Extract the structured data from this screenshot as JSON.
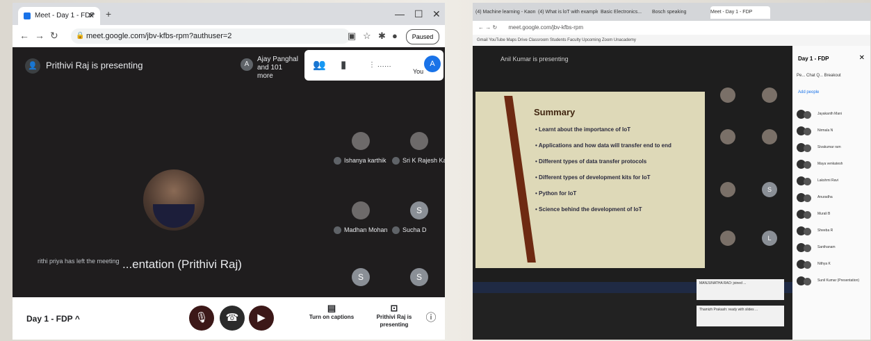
{
  "left": {
    "tab_title": "Meet - Day 1 - FDP",
    "url": "meet.google.com/jbv-kfbs-rpm?authuser=2",
    "paused_label": "Paused",
    "presenting_label": "Prithivi Raj is presenting",
    "joiners": {
      "initial": "A",
      "text": "Ajay Panghal and 101 more"
    },
    "you_label": "You",
    "you_initial": "A",
    "main_caption": "...entation (Prithivi Raj)",
    "left_notice": "rithi priya has left the meeting",
    "participants": [
      {
        "name": "Ishanya karthik",
        "initial": ""
      },
      {
        "name": "Sri K Rajesh Ka",
        "initial": ""
      },
      {
        "name": "Madhan Mohan",
        "initial": ""
      },
      {
        "name": "Sucha D",
        "initial": "S"
      },
      {
        "name": "",
        "initial": "S"
      },
      {
        "name": "",
        "initial": "S"
      }
    ],
    "meeting_name": "Day 1 - FDP",
    "captions_label": "Turn on captions",
    "present_label": "Prithivi Raj is presenting"
  },
  "right": {
    "tabs": [
      "(4) Machine learning - Kaon...",
      "(4) What is loT with example",
      "Basic Electronics...",
      "Bosch speaking",
      "Meet - Day 1 - FDP"
    ],
    "address": "meet.google.com/jbv-kfbs-rpm",
    "bookmarks": "Gmail  YouTube  Maps  Drive  Classroom  Students  Faculty  Upcoming  Zoom  Unacademy",
    "presenting_label": "Anil Kumar is presenting",
    "slide": {
      "title": "Summary",
      "bullets": [
        "Learnt about the importance of IoT",
        "Applications and how data will transfer end to end",
        "Different types of data transfer protocols",
        "Different types of development kits for IoT",
        "Python for IoT",
        "Science behind the development of IoT"
      ]
    },
    "tile_letters": [
      "S",
      "L"
    ],
    "sidebar": {
      "title": "Day 1 - FDP",
      "tabs": "Pe...  Chat  Q...  Breakout",
      "add_people": "Add people",
      "names": [
        "Jayakanth Mani",
        "Nirmala N",
        "Sivakumar ram",
        "Maya venkatesh",
        "Lakshmi Ravi",
        "Anuradha",
        "Murali B",
        "Sheeba R",
        "Santhanam",
        "Nithya K",
        "Sunil Kumar (Presentation)"
      ]
    },
    "cards": [
      "MANJUNATHA RAO: joined ...",
      "Thamizh Prakash: ready with slides ..."
    ]
  }
}
